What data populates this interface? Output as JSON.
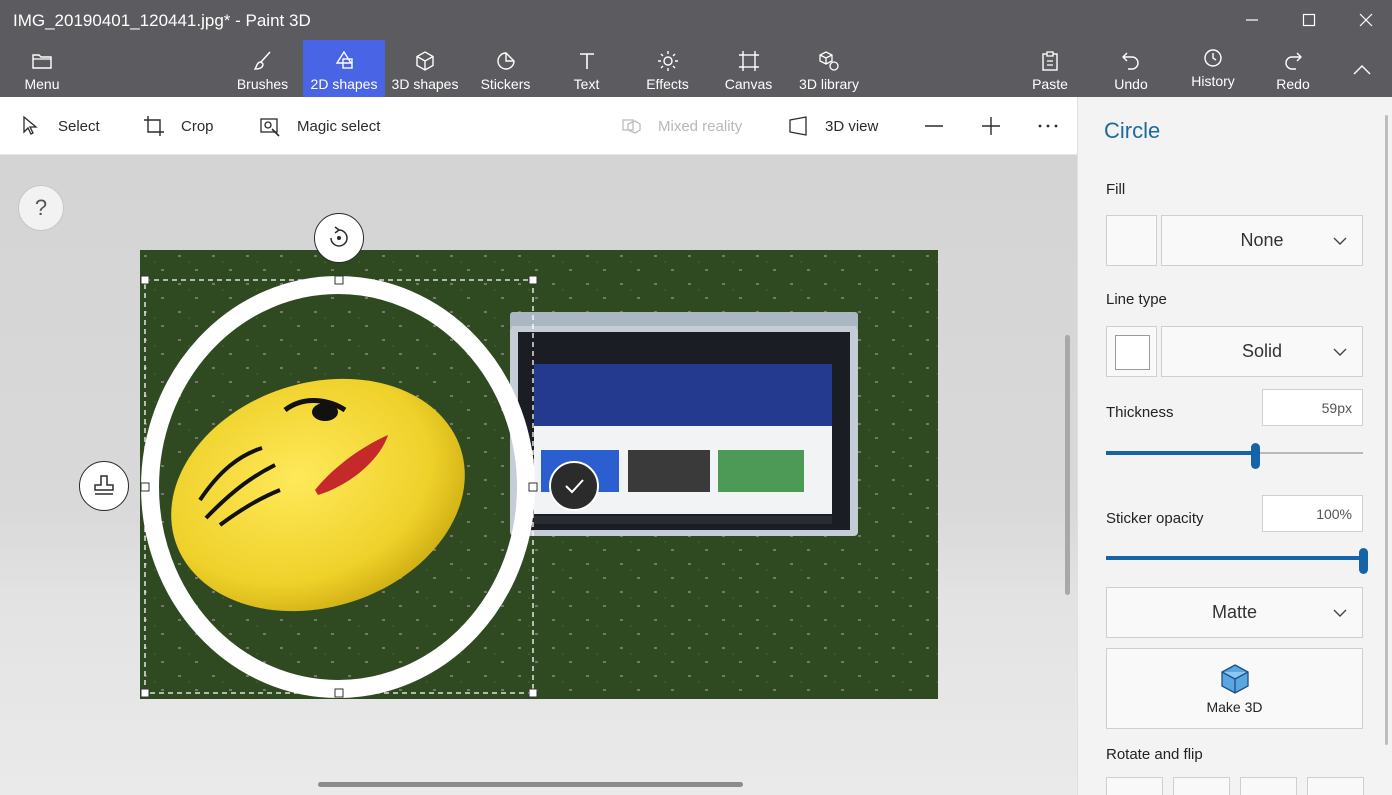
{
  "window": {
    "title": "IMG_20190401_120441.jpg* - Paint 3D",
    "minimize": "minimize",
    "maximize": "maximize",
    "close": "close"
  },
  "ribbon": {
    "menu": "Menu",
    "tabs": [
      "Brushes",
      "2D shapes",
      "3D shapes",
      "Stickers",
      "Text",
      "Effects",
      "Canvas",
      "3D library"
    ],
    "active_tab": "2D shapes",
    "actions": [
      "Paste",
      "Undo",
      "History",
      "Redo"
    ]
  },
  "toolbar": {
    "select": "Select",
    "crop": "Crop",
    "magic_select": "Magic select",
    "mixed_reality": "Mixed reality",
    "view_3d": "3D view"
  },
  "canvas": {
    "help": "?"
  },
  "panel": {
    "title": "Circle",
    "fill_label": "Fill",
    "fill_value": "None",
    "line_type_label": "Line type",
    "line_type_value": "Solid",
    "thickness_label": "Thickness",
    "thickness_value": "59px",
    "thickness_level": 0.58,
    "sticker_opacity_label": "Sticker opacity",
    "sticker_opacity_value": "100%",
    "sticker_opacity_level": 1.0,
    "finish_value": "Matte",
    "make3d_label": "Make 3D",
    "rotate_flip_label": "Rotate and flip"
  },
  "colors": {
    "titlebar": "#5c5b5f",
    "active_tab": "#4a64e6",
    "accent": "#1664a8",
    "panel_title": "#1f6a9c",
    "carpet": "#2f4a21",
    "emoji_yellow": "#f2d72a"
  }
}
